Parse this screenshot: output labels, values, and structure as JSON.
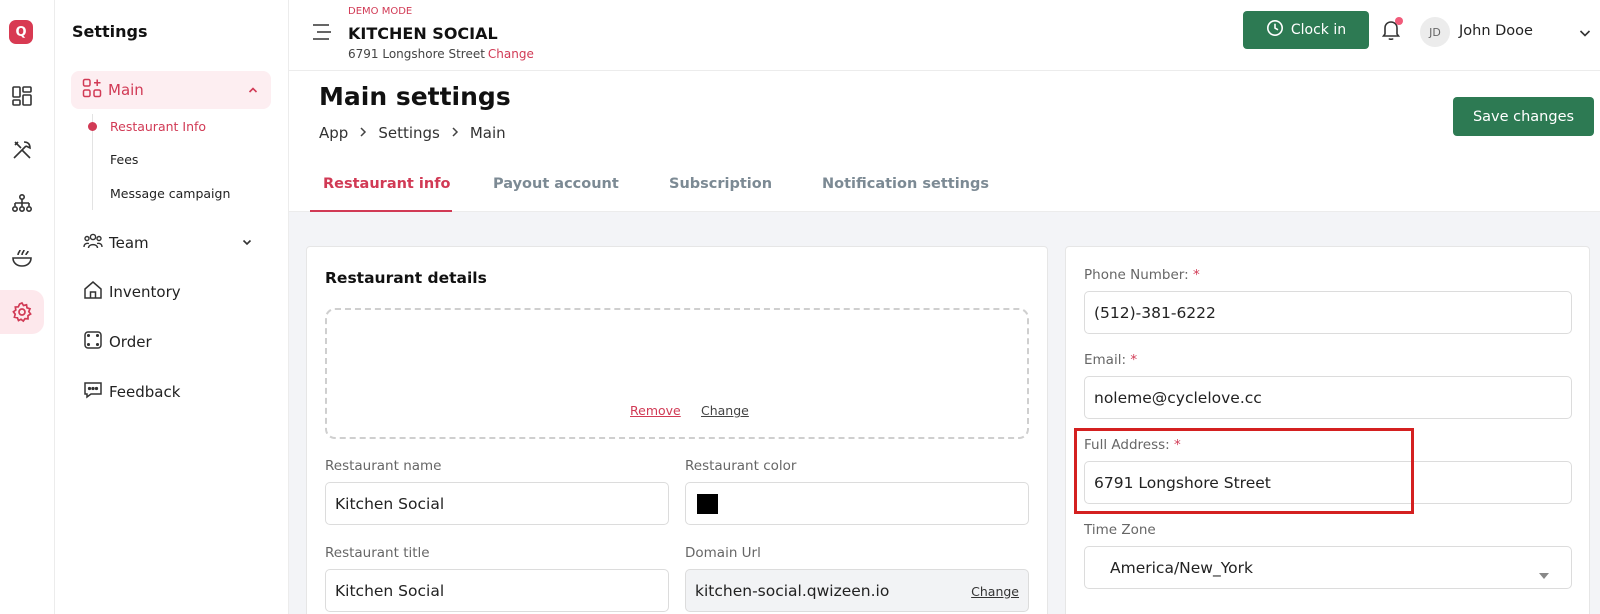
{
  "rail": {
    "logo_letter": "Q",
    "items": [
      "dashboard-icon",
      "utensils-icon",
      "org-chart-icon",
      "food-bowl-icon",
      "gear-icon"
    ],
    "active_item": "gear-icon",
    "accent": "#d83a52"
  },
  "sidebar": {
    "title": "Settings",
    "main_label": "Main",
    "sub_items": [
      "Restaurant Info",
      "Fees",
      "Message campaign"
    ],
    "active_sub": "Restaurant Info",
    "team_label": "Team",
    "inventory_label": "Inventory",
    "order_label": "Order",
    "feedback_label": "Feedback"
  },
  "header": {
    "mode": "DEMO MODE",
    "restaurant_name": "KITCHEN SOCIAL",
    "address": "6791 Longshore Street",
    "change_label": "Change",
    "clock_in_label": "Clock in",
    "user_initials": "JD",
    "user_name": "John Dooe"
  },
  "page": {
    "title": "Main settings",
    "breadcrumb": [
      "App",
      "Settings",
      "Main"
    ],
    "save_label": "Save changes"
  },
  "tabs": [
    "Restaurant info",
    "Payout account",
    "Subscription",
    "Notification settings"
  ],
  "active_tab": "Restaurant info",
  "restaurant_details": {
    "title": "Restaurant details",
    "remove_label": "Remove",
    "change_label": "Change",
    "name_label": "Restaurant name",
    "name_value": "Kitchen Social",
    "color_label": "Restaurant color",
    "color_value": "#000000",
    "title_label": "Restaurant title",
    "title_value": "Kitchen Social",
    "domain_label": "Domain Url",
    "domain_value": "kitchen-social.qwizeen.io",
    "domain_change": "Change"
  },
  "contact": {
    "phone_label": "Phone Number:",
    "phone_value": "(512)-381-6222",
    "email_label": "Email:",
    "email_value": "noleme@cyclelove.cc",
    "address_label": "Full Address:",
    "address_value": "6791 Longshore Street",
    "timezone_label": "Time Zone",
    "timezone_value": "America/New_York",
    "required_mark": "*"
  },
  "colors": {
    "brand_red": "#d13a55",
    "primary_green": "#2d7a53",
    "highlight": "#d42020"
  }
}
